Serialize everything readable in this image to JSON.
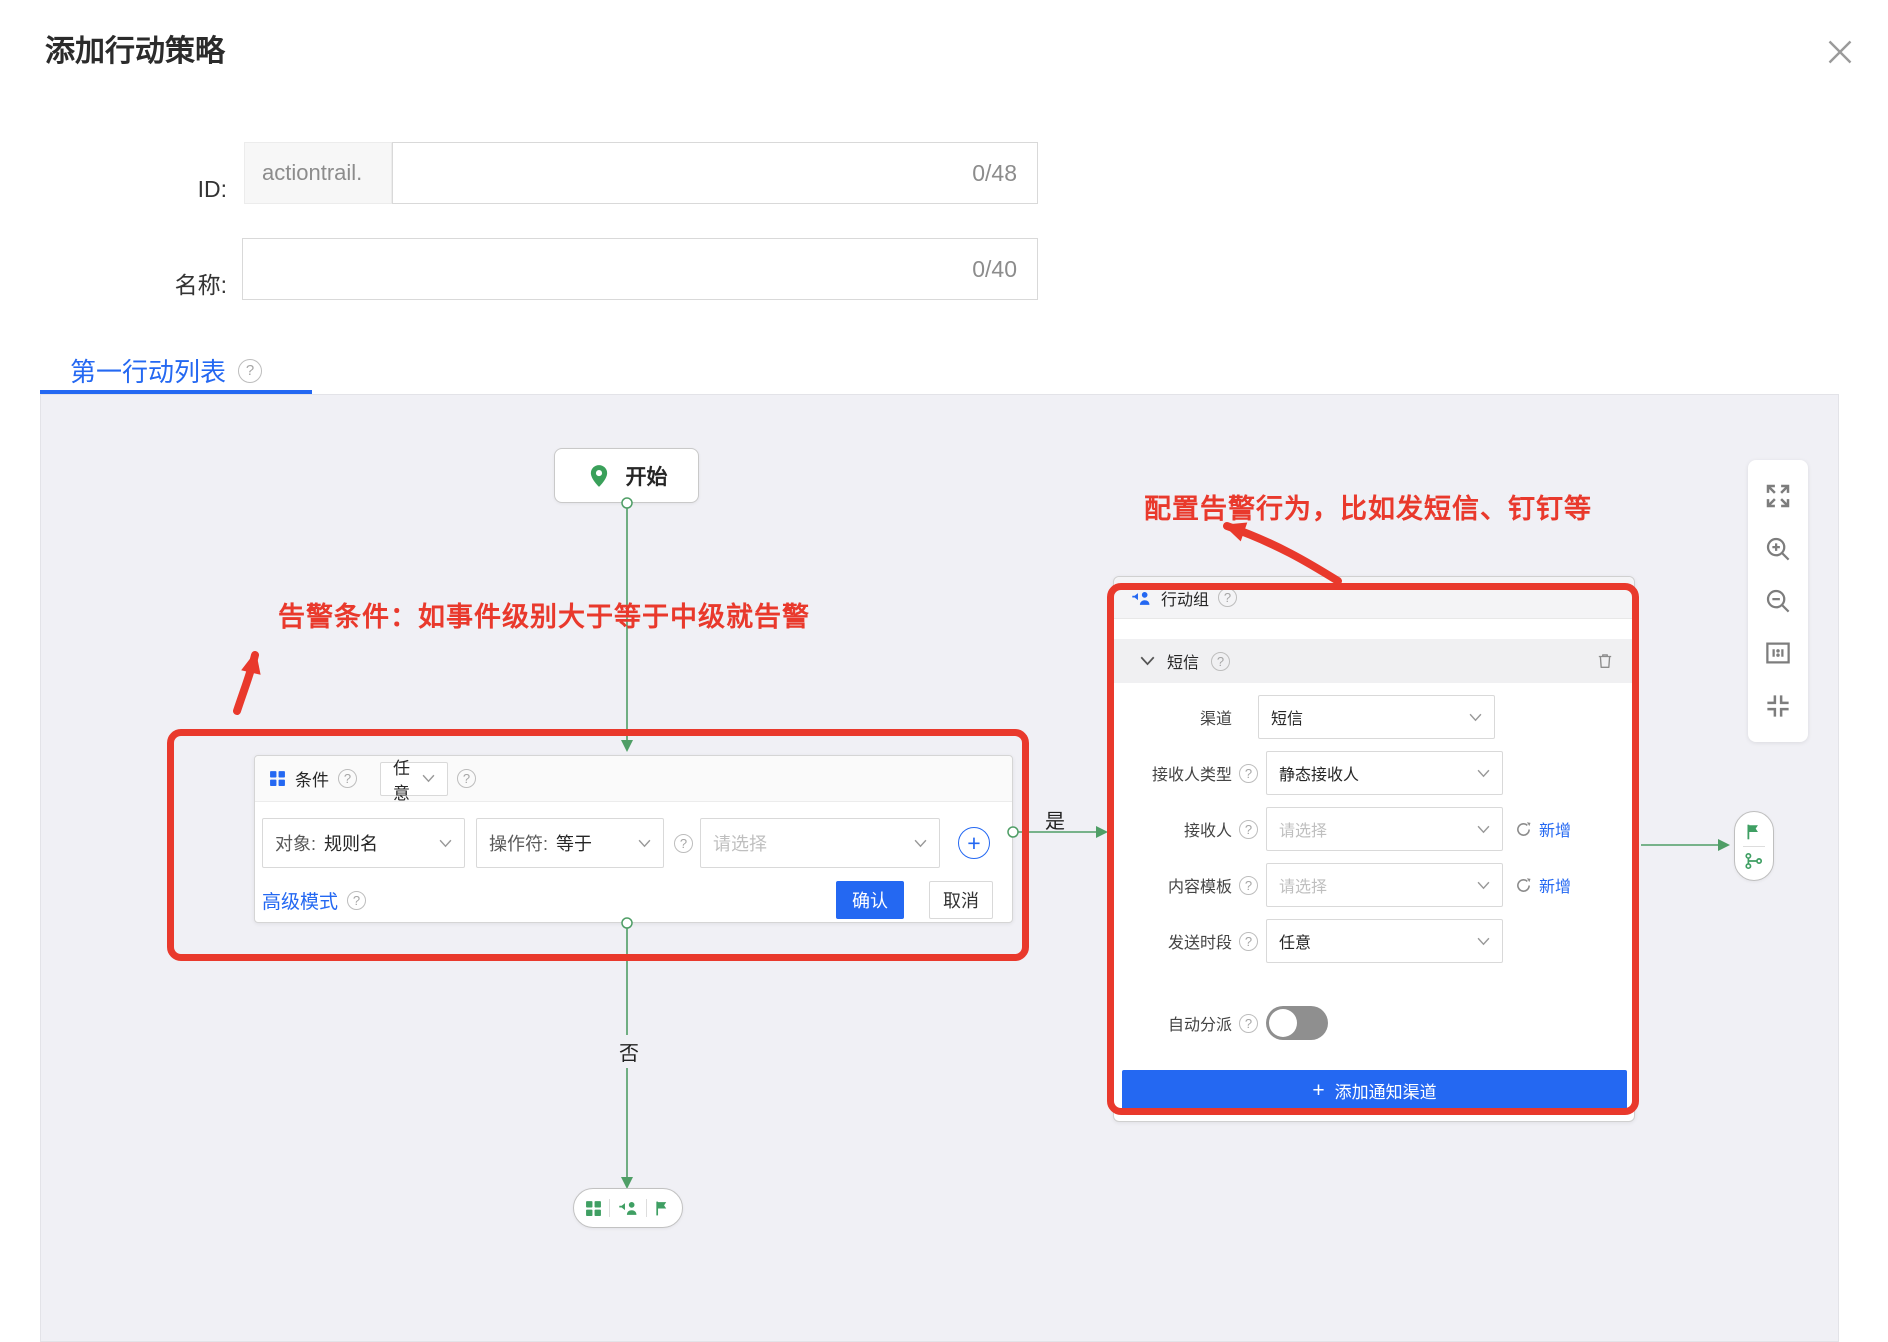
{
  "dialog": {
    "title": "添加行动策略"
  },
  "form": {
    "id": {
      "label": "ID:",
      "prefix": "actiontrail.",
      "value": "",
      "counter": "0/48"
    },
    "name": {
      "label": "名称:",
      "value": "",
      "counter": "0/40"
    }
  },
  "tabs": {
    "active": "第一行动列表"
  },
  "canvas": {
    "start_node": {
      "label": "开始"
    },
    "annotations": {
      "condition_note": "告警条件：如事件级别大于等于中级就告警",
      "action_note": "配置告警行为，比如发短信、钉钉等"
    },
    "edges": {
      "yes_label": "是",
      "no_label": "否"
    },
    "condition_node": {
      "title": "条件",
      "match_mode": "任意",
      "object_label": "对象:",
      "object_value": "规则名",
      "operator_label": "操作符:",
      "operator_value": "等于",
      "value_placeholder": "请选择",
      "advanced_link": "高级模式",
      "confirm": "确认",
      "cancel": "取消"
    },
    "action_node": {
      "group_title": "行动组",
      "channel_section": "短信",
      "fields": {
        "channel": {
          "label": "渠道",
          "value": "短信"
        },
        "recipient_type": {
          "label": "接收人类型",
          "value": "静态接收人"
        },
        "recipient": {
          "label": "接收人",
          "placeholder": "请选择",
          "add": "新增"
        },
        "template": {
          "label": "内容模板",
          "placeholder": "请选择",
          "add": "新增"
        },
        "period": {
          "label": "发送时段",
          "value": "任意"
        },
        "auto_dispatch": {
          "label": "自动分派",
          "state": "off"
        }
      },
      "add_channel_button": "添加通知渠道"
    }
  },
  "icons": {
    "help_glyph": "?",
    "plus_glyph": "+"
  },
  "colors": {
    "accent": "#2468f2",
    "annotation_red": "#e9392c",
    "flow_green": "#4f9e66",
    "canvas_bg": "#f0f0f5"
  }
}
